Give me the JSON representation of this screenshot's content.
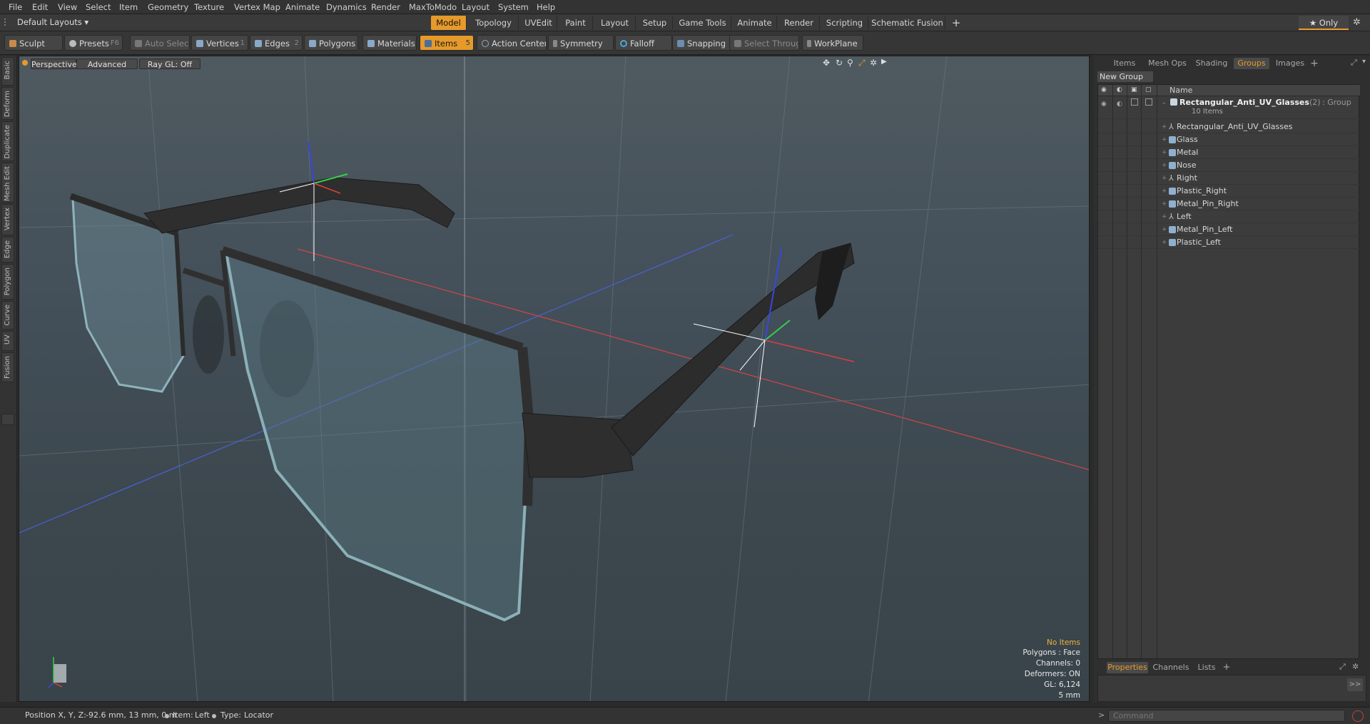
{
  "menubar": {
    "items": [
      "File",
      "Edit",
      "View",
      "Select",
      "Item",
      "Geometry",
      "Texture",
      "Vertex Map",
      "Animate",
      "Dynamics",
      "Render",
      "MaxToModo",
      "Layout",
      "System",
      "Help"
    ]
  },
  "layouts": {
    "label": "Default Layouts ▾"
  },
  "tabs": [
    "Model",
    "Topology",
    "UVEdit",
    "Paint",
    "Layout",
    "Setup",
    "Game Tools",
    "Animate",
    "Render",
    "Scripting",
    "Schematic Fusion"
  ],
  "tabs_add": "+",
  "only_button": "★ Only",
  "toolbar": {
    "sculpt": "Sculpt",
    "presets": "Presets",
    "presets_key": "F6",
    "auto_select": "Auto Select",
    "vertices": "Vertices",
    "vertices_num": "1",
    "edges": "Edges",
    "edges_num": "2",
    "polygons": "Polygons",
    "materials": "Materials",
    "items": "Items",
    "items_num": "5",
    "action_center": "Action Center",
    "symmetry": "Symmetry",
    "falloff": "Falloff",
    "snapping": "Snapping",
    "select_through": "Select Through",
    "workplane": "WorkPlane"
  },
  "left_tabs": [
    "Basic",
    "Deform",
    "Duplicate",
    "Mesh Edit",
    "Vertex",
    "Edge",
    "Polygon",
    "Curve",
    "UV",
    "Fusion"
  ],
  "viewport": {
    "view": "Perspective",
    "shading": "Advanced",
    "raygl": "Ray GL: Off",
    "info": {
      "items": "No Items",
      "polygons": "Polygons : Face",
      "channels": "Channels: 0",
      "deformers": "Deformers: ON",
      "gl": "GL: 6,124",
      "scale": "5 mm"
    }
  },
  "right_panel": {
    "tabs": [
      "Items",
      "Mesh Ops",
      "Shading",
      "Groups",
      "Images"
    ],
    "active_tab": "Groups",
    "tabs_add": "+",
    "new_group": "New Group",
    "col_name": "Name",
    "group": {
      "name": "Rectangular_Anti_UV_Glasses",
      "count": "(2)",
      "type": ": Group",
      "subtitle": "10 Items"
    },
    "items": [
      {
        "name": "Rectangular_Anti_UV_Glasses",
        "kind": "locator"
      },
      {
        "name": "Glass",
        "kind": "mesh"
      },
      {
        "name": "Metal",
        "kind": "mesh"
      },
      {
        "name": "Nose",
        "kind": "mesh"
      },
      {
        "name": "Right",
        "kind": "locator"
      },
      {
        "name": "Plastic_Right",
        "kind": "mesh"
      },
      {
        "name": "Metal_Pin_Right",
        "kind": "mesh"
      },
      {
        "name": "Left",
        "kind": "locator"
      },
      {
        "name": "Metal_Pin_Left",
        "kind": "mesh"
      },
      {
        "name": "Plastic_Left",
        "kind": "mesh"
      }
    ],
    "bottom_tabs": [
      "Properties",
      "Channels",
      "Lists"
    ],
    "bottom_active": "Properties",
    "bottom_add": "+",
    "expand": ">>"
  },
  "status": {
    "position_label": "Position X, Y, Z:",
    "position_value": "-92.6 mm, 13 mm, 0 m",
    "item_label": "Item:",
    "item_value": "Left",
    "type_label": "Type:",
    "type_value": "Locator"
  },
  "command": {
    "placeholder": "Command"
  },
  "colors": {
    "accent": "#e59a2b",
    "viewport_bg": "#44505a"
  }
}
